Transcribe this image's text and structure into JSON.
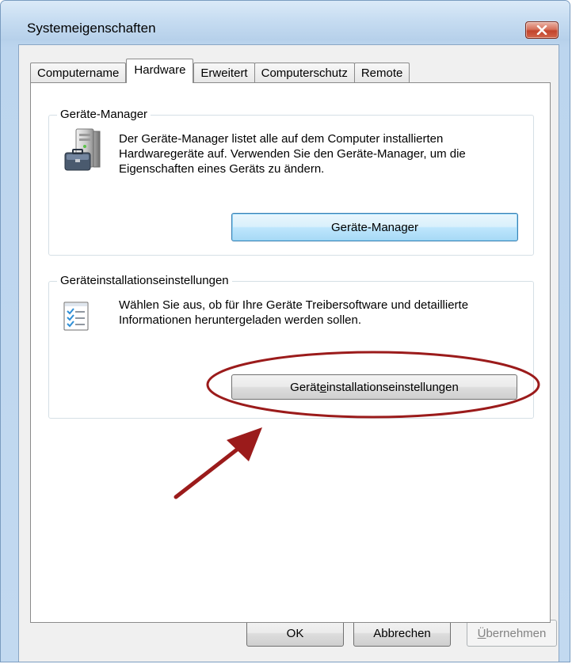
{
  "window": {
    "title": "Systemeigenschaften",
    "close_symbol": "✕"
  },
  "tabs": [
    {
      "label": "Computername",
      "active": false
    },
    {
      "label": "Hardware",
      "active": true
    },
    {
      "label": "Erweitert",
      "active": false
    },
    {
      "label": "Computerschutz",
      "active": false
    },
    {
      "label": "Remote",
      "active": false
    }
  ],
  "device_manager": {
    "group_title": "Geräte-Manager",
    "description": "Der Geräte-Manager listet alle auf dem Computer installierten Hardwaregeräte auf. Verwenden Sie den Geräte-Manager, um die Eigenschaften eines Geräts zu ändern.",
    "button_label": "Geräte-Manager",
    "icon": "device-manager-icon"
  },
  "device_installation": {
    "group_title": "Geräteinstallationseinstellungen",
    "description": "Wählen Sie aus, ob für Ihre Geräte Treibersoftware und detaillierte Informationen heruntergeladen werden sollen.",
    "button_label_pre": "Gerät",
    "button_label_accel": "e",
    "button_label_post": "installationseinstellungen",
    "icon": "checklist-icon"
  },
  "footer": {
    "ok_label": "OK",
    "cancel_label": "Abbrechen",
    "apply_label_accel": "Ü",
    "apply_label_rest": "bernehmen"
  },
  "annotation": {
    "color": "#9b1b1b"
  }
}
